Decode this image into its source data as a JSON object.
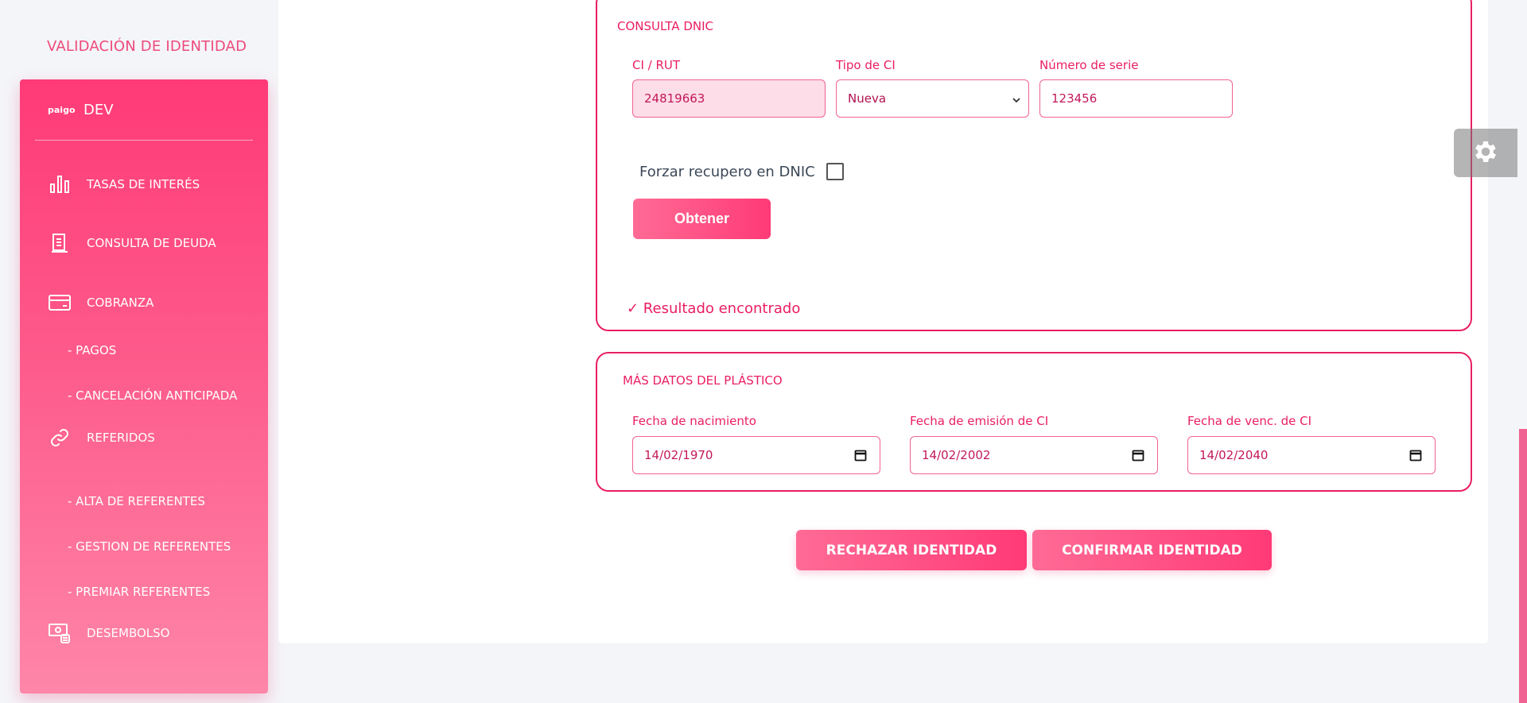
{
  "page": {
    "heading": "VALIDACIÓN DE IDENTIDAD"
  },
  "sidebar": {
    "brand_logo": "paigo",
    "brand_name": "DEV",
    "items": [
      {
        "label": "TASAS DE INTERÉS",
        "icon": "bar-chart-icon"
      },
      {
        "label": "CONSULTA DE DEUDA",
        "icon": "document-icon"
      },
      {
        "label": "COBRANZA",
        "icon": "credit-card-icon"
      },
      {
        "label": "- PAGOS"
      },
      {
        "label": "- CANCELACIÓN ANTICIPADA"
      },
      {
        "label": "REFERIDOS",
        "icon": "link-icon"
      },
      {
        "label": "- ALTA DE REFERENTES"
      },
      {
        "label": "- GESTION DE REFERENTES"
      },
      {
        "label": "- PREMIAR REFERENTES"
      },
      {
        "label": "DESEMBOLSO",
        "icon": "money-icon"
      }
    ]
  },
  "dnic": {
    "title": "CONSULTA DNIC",
    "ci_label": "CI / RUT",
    "ci_value": "24819663",
    "tipo_label": "Tipo de CI",
    "tipo_value": "Nueva",
    "serie_label": "Número de serie",
    "serie_value": "123456",
    "forzar_label": "Forzar recupero en DNIC",
    "forzar_checked": false,
    "obtener_label": "Obtener",
    "result": "✓ Resultado encontrado"
  },
  "plastico": {
    "title": "MÁS DATOS DEL PLÁSTICO",
    "nacimiento_label": "Fecha de nacimiento",
    "nacimiento_value": "14/02/1970",
    "emision_label": "Fecha de emisión de CI",
    "emision_value": "14/02/2002",
    "venc_label": "Fecha de venc. de CI",
    "venc_value": "14/02/2040"
  },
  "actions": {
    "reject_label": "RECHAZAR IDENTIDAD",
    "confirm_label": "CONFIRMAR IDENTIDAD"
  },
  "colors": {
    "accent": "#e91e63",
    "sidebar_top": "#ff3a77",
    "sidebar_bottom": "#fe86a8"
  },
  "settings": {
    "icon": "gear-icon"
  }
}
